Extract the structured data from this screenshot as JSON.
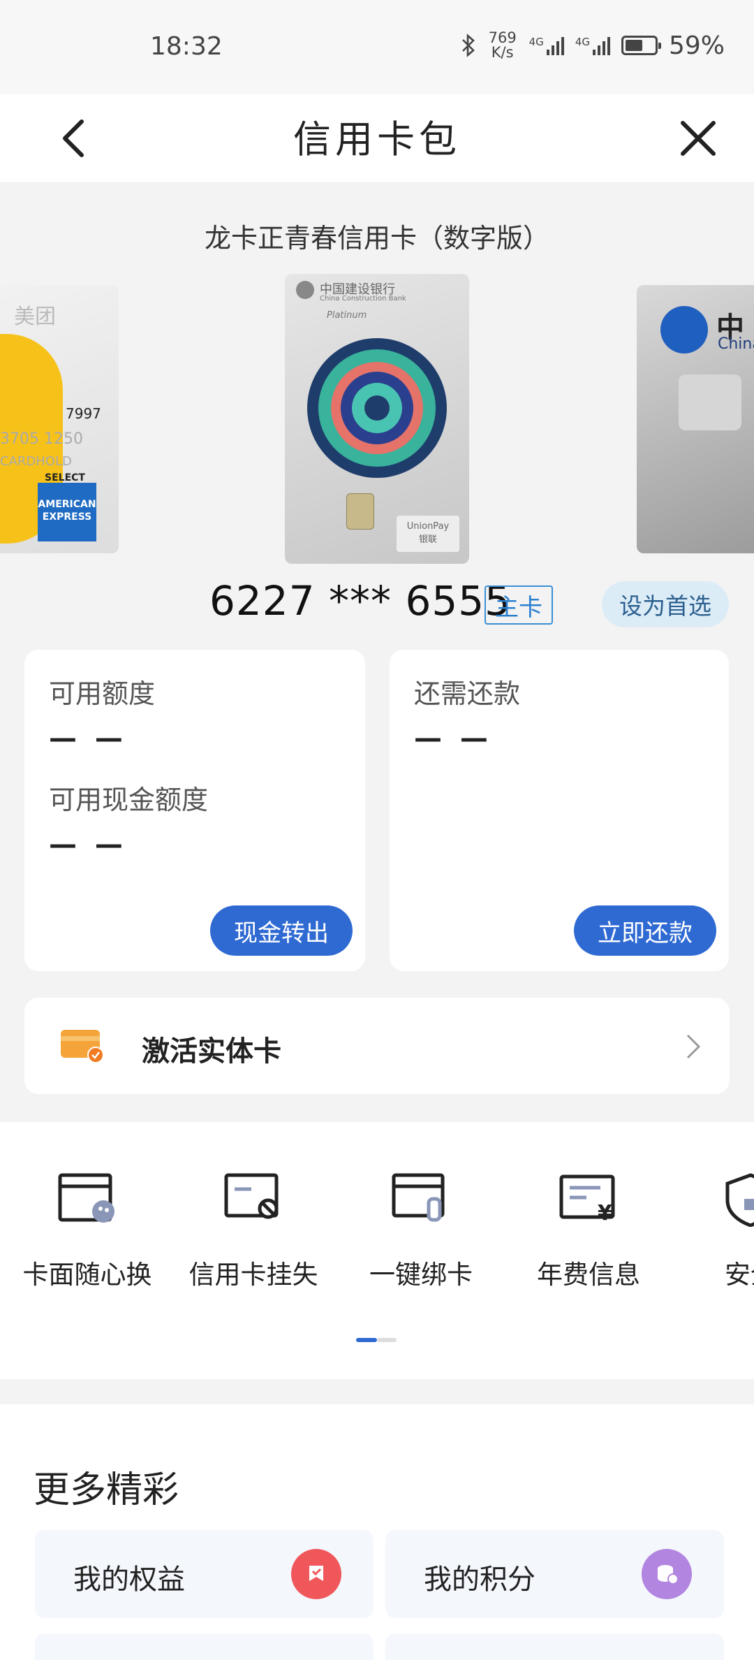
{
  "status_bar": {
    "time": "18:32",
    "speed_value": "769",
    "speed_unit": "K/s",
    "net1": "4G",
    "net2": "4G",
    "battery": "59%",
    "battery_level": 0.59
  },
  "header": {
    "title": "信用卡包"
  },
  "card": {
    "name": "龙卡正青春信用卡（数字版）",
    "number": "6227 *** 6555",
    "type_badge": "主卡",
    "prefer_button": "设为首选",
    "left_card": {
      "brand": "美团",
      "digits": "7997",
      "line2": "3705 1250",
      "line3": "CARDHOLD",
      "select": "SELECT",
      "network": "AMERICAN EXPRESS"
    },
    "center_card": {
      "bank": "中国建设银行",
      "bank_en": "China Construction Bank",
      "tier": "Platinum",
      "network": "UnionPay",
      "network_cn": "银联"
    },
    "right_card": {
      "bank": "中",
      "bank_en": "China"
    }
  },
  "balances": {
    "available_label": "可用额度",
    "available_value": "— —",
    "cash_label": "可用现金额度",
    "cash_value": "— —",
    "cash_button": "现金转出",
    "due_label": "还需还款",
    "due_value": "— —",
    "repay_button": "立即还款"
  },
  "activate": {
    "label": "激活实体卡"
  },
  "tools": [
    {
      "label": "卡面随心换",
      "icon": "card-palette-icon"
    },
    {
      "label": "信用卡挂失",
      "icon": "card-block-icon"
    },
    {
      "label": "一键绑卡",
      "icon": "card-link-icon"
    },
    {
      "label": "年费信息",
      "icon": "annual-fee-icon"
    },
    {
      "label": "安全",
      "icon": "shield-lock-icon"
    }
  ],
  "more": {
    "title": "更多精彩",
    "tiles": [
      {
        "label": "我的权益",
        "icon": "rights-icon",
        "color": "#f0575a"
      },
      {
        "label": "我的积分",
        "icon": "points-icon",
        "color": "#b185e0"
      }
    ]
  },
  "colors": {
    "accent": "#2f6ad3",
    "badge": "#2a80cf"
  }
}
